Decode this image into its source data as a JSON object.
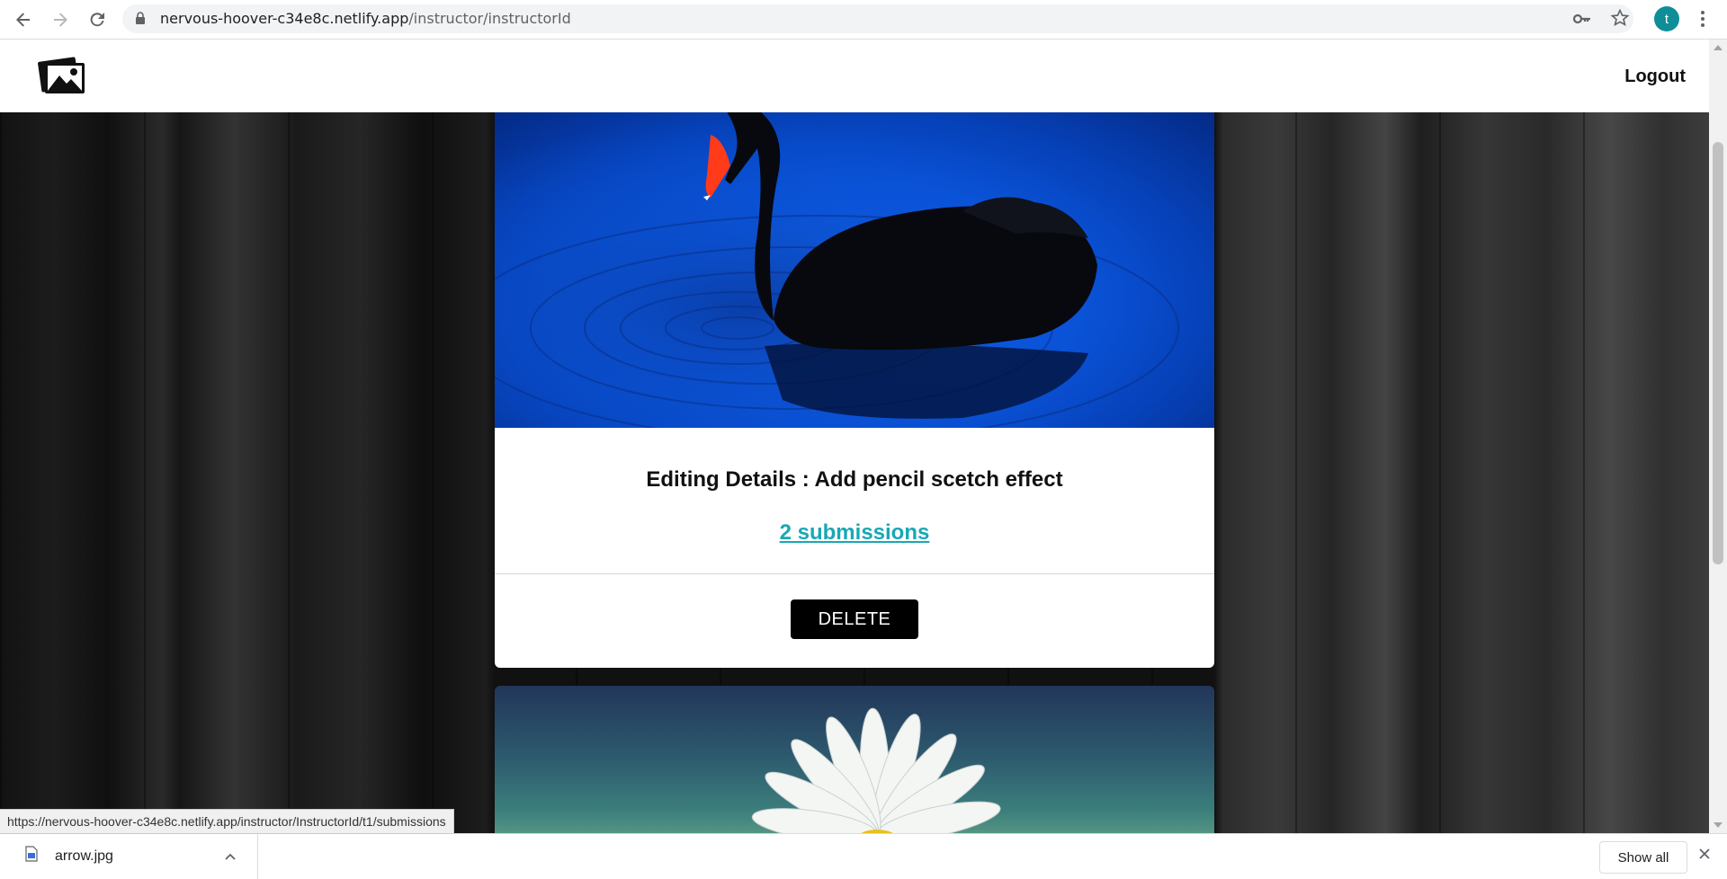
{
  "browser": {
    "url_host": "nervous-hoover-c34e8c.netlify.app",
    "url_path": "/instructor/instructorId",
    "avatar_letter": "t",
    "status_url": "https://nervous-hoover-c34e8c.netlify.app/instructor/InstructorId/t1/submissions"
  },
  "header": {
    "logout_label": "Logout"
  },
  "cards": [
    {
      "title": "Editing Details : Add pencil scetch effect",
      "submissions_label": "2 submissions",
      "delete_label": "DELETE"
    }
  ],
  "downloads": {
    "file_name": "arrow.jpg",
    "show_all_label": "Show all"
  },
  "colors": {
    "submissions_link": "#1aa7b5",
    "delete_bg": "#000000",
    "avatar_bg": "#0e8e99"
  }
}
